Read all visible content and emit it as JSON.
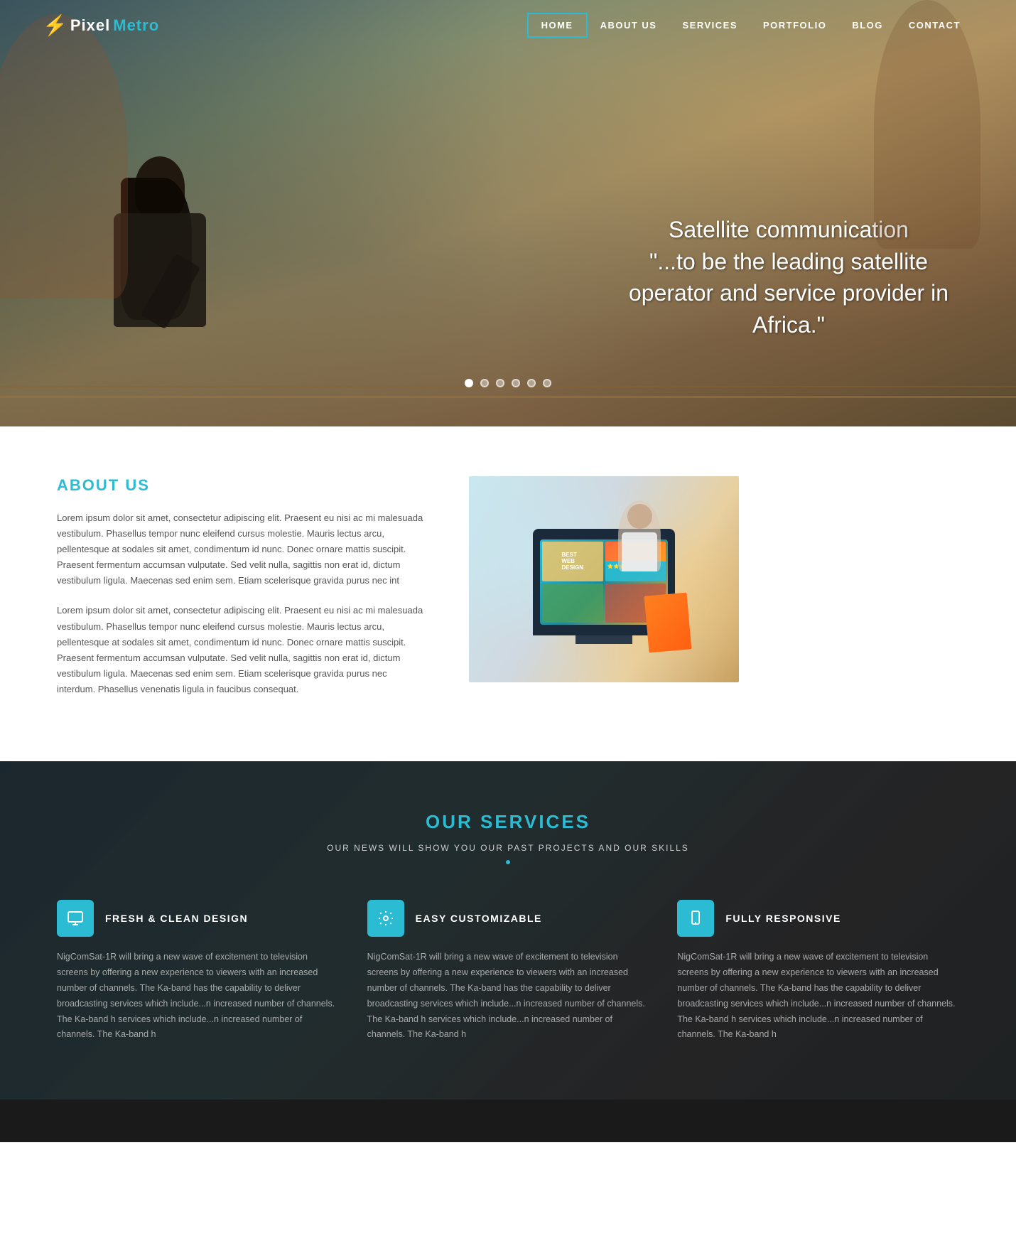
{
  "logo": {
    "icon": "⚡",
    "pixel": "Pixel",
    "metro": "Metro"
  },
  "nav": {
    "items": [
      {
        "label": "HOME",
        "active": true
      },
      {
        "label": "ABOUT US",
        "active": false
      },
      {
        "label": "SERVICES",
        "active": false
      },
      {
        "label": "PORTFOLIO",
        "active": false
      },
      {
        "label": "BLOG",
        "active": false
      },
      {
        "label": "CONTACT",
        "active": false
      }
    ]
  },
  "hero": {
    "line1": "Satellite communication",
    "line2": "\"...to be the leading satellite",
    "line3": "operator and service provider in Africa.\""
  },
  "about": {
    "title": "ABOUT US",
    "paragraph1": "Lorem ipsum dolor sit amet, consectetur adipiscing elit. Praesent eu nisi ac mi malesuada vestibulum. Phasellus tempor nunc eleifend cursus molestie. Mauris lectus arcu, pellentesque at sodales sit amet, condimentum id nunc. Donec ornare mattis suscipit. Praesent fermentum accumsan vulputate. Sed velit nulla, sagittis non erat id, dictum vestibulum ligula. Maecenas sed enim sem. Etiam scelerisque gravida purus nec int",
    "paragraph2": "Lorem ipsum dolor sit amet, consectetur adipiscing elit. Praesent eu nisi ac mi malesuada vestibulum. Phasellus tempor nunc eleifend cursus molestie. Mauris lectus arcu, pellentesque at sodales sit amet, condimentum id nunc. Donec ornare mattis suscipit. Praesent fermentum accumsan vulputate. Sed velit nulla, sagittis non erat id, dictum vestibulum ligula. Maecenas sed enim sem. Etiam scelerisque gravida purus nec interdum. Phasellus venenatis ligula in faucibus consequat."
  },
  "services": {
    "title": "OUR SERVICES",
    "subtitle": "OUR NEWS WILL SHOW YOU OUR PAST PROJECTS AND OUR SKILLS",
    "cards": [
      {
        "icon": "🖥",
        "title": "FRESH & CLEAN DESIGN",
        "text": "NigComSat-1R will bring a new wave of excitement to television screens by offering a new experience to viewers with an increased number of channels. The Ka-band has the capability to deliver broadcasting services which include...n increased number of channels. The Ka-band h services which include...n increased number of channels. The Ka-band h"
      },
      {
        "icon": "⚙",
        "title": "EASY CUSTOMIZABLE",
        "text": "NigComSat-1R will bring a new wave of excitement to television screens by offering a new experience to viewers with an increased number of channels. The Ka-band has the capability to deliver broadcasting services which include...n increased number of channels. The Ka-band h services which include...n increased number of channels. The Ka-band h"
      },
      {
        "icon": "📱",
        "title": "FULLY RESPONSIVE",
        "text": "NigComSat-1R will bring a new wave of excitement to television screens by offering a new experience to viewers with an increased number of channels. The Ka-band has the capability to deliver broadcasting services which include...n increased number of channels. The Ka-band h services which include...n increased number of channels. The Ka-band h"
      }
    ]
  }
}
